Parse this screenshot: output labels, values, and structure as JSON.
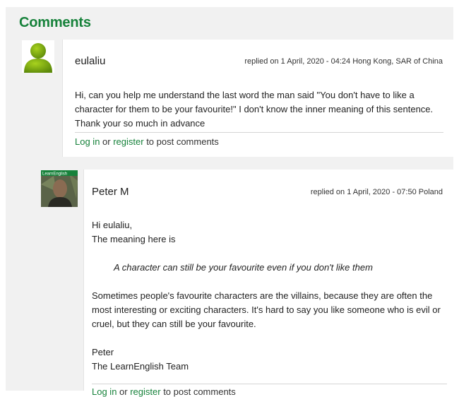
{
  "section": {
    "title": "Comments"
  },
  "comments": [
    {
      "author": "eulaliu",
      "meta": "replied on 1 April, 2020 - 04:24 Hong Kong, SAR of China",
      "body": "Hi, can you help me understand the last word the man said \"You don't have to like a character for them to be your favourite!\" I don't know the inner meaning of this sentence. Thank your so much in advance",
      "login_label": "Log in",
      "or_text": " or ",
      "register_label": "register",
      "post_text": " to post comments"
    },
    {
      "author": "Peter M",
      "avatar_badge": "LearnEnglish",
      "meta": "replied on 1 April, 2020 - 07:50 Poland",
      "greeting": "Hi eulaliu,",
      "intro": "The meaning here is",
      "quote": "A character can still be your favourite even if you don't like them",
      "paragraph": "Sometimes people's favourite characters are the villains, because they are often the most interesting or exciting characters. It's hard to say you like someone who is evil or cruel, but they can still be your favourite.",
      "signoff_name": "Peter",
      "signoff_team": "The LearnEnglish Team",
      "login_label": "Log in",
      "or_text": " or ",
      "register_label": "register",
      "post_text": " to post comments"
    }
  ],
  "colors": {
    "accent": "#17823b",
    "panel": "#f1f1f1",
    "avatar_default": "#7fae15"
  }
}
